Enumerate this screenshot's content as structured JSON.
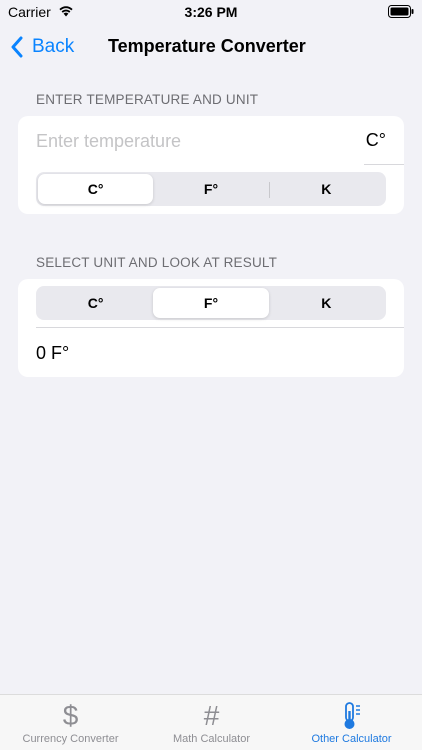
{
  "status_bar": {
    "carrier": "Carrier",
    "time": "3:26 PM"
  },
  "nav": {
    "back_label": "Back",
    "title": "Temperature Converter"
  },
  "input_section": {
    "header": "ENTER TEMPERATURE AND UNIT",
    "placeholder": "Enter temperature",
    "value": "",
    "unit_label": "C°",
    "segments": [
      "C°",
      "F°",
      "K"
    ],
    "selected": "C°"
  },
  "result_section": {
    "header": "SELECT UNIT AND LOOK AT RESULT",
    "segments": [
      "C°",
      "F°",
      "K"
    ],
    "selected": "F°",
    "result": "0 F°"
  },
  "tabs": [
    {
      "label": "Currency Converter",
      "icon": "dollar-icon",
      "glyph": "$",
      "active": false
    },
    {
      "label": "Math Calculator",
      "icon": "hashtag-icon",
      "glyph": "#",
      "active": false
    },
    {
      "label": "Other Calculator",
      "icon": "thermometer-icon",
      "active": true
    }
  ],
  "colors": {
    "accent": "#0a84ff",
    "tab_active": "#1f7ae0",
    "background": "#f2f2f7"
  }
}
